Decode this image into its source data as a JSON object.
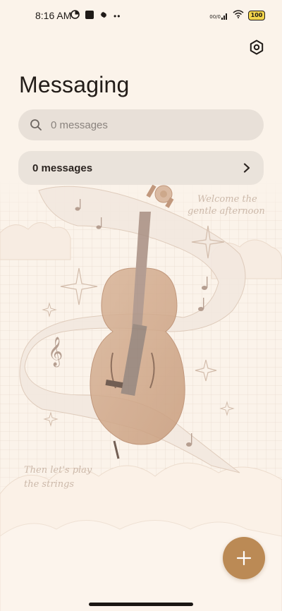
{
  "status_bar": {
    "time": "8:16 AM",
    "left_icons": [
      "data-saver-icon",
      "square-notification-icon",
      "settings-gear-icon",
      "more-dots-icon"
    ],
    "right_icons": [
      "signal-icon",
      "wifi-icon",
      "battery-icon"
    ],
    "signal_text": "00/0",
    "battery_level": "100",
    "battery_color": "#f2d44b"
  },
  "header": {
    "title": "Messaging",
    "settings_icon": "settings-hexagon-icon"
  },
  "search": {
    "placeholder": "0 messages",
    "value": "",
    "icon": "search-icon"
  },
  "conversation_summary": {
    "label": "0 messages",
    "icon": "chevron-right-icon"
  },
  "background_art": {
    "text_top_line1": "Welcome the",
    "text_top_line2": "gentle afternoon",
    "text_bottom_line1": "Then let's play",
    "text_bottom_line2": "the strings"
  },
  "fab": {
    "icon": "plus-icon",
    "color": "#bb8a55"
  },
  "colors": {
    "background": "#fbf3ea",
    "accent": "#bb8a55",
    "surface": "#e8e1d9"
  }
}
